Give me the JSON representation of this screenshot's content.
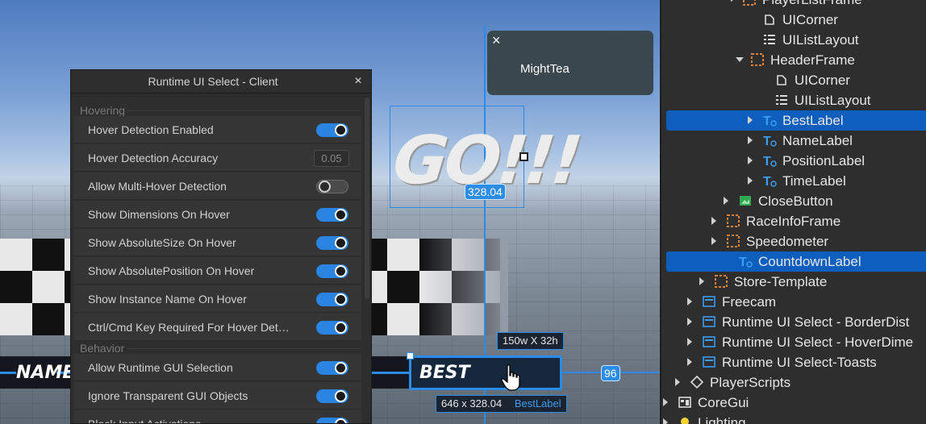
{
  "viewport": {
    "go_text": "GO!!!",
    "go_width_pill": "328.04",
    "name_label": "NAME",
    "best_label": "BEST",
    "size_tag": "150w X 32h",
    "right_gap_pill": "96",
    "position_tag": "646 x 328.04",
    "position_tag_name": "BestLabel",
    "colors": {
      "accent": "#2a8be8",
      "selection": "#0e5fbd"
    }
  },
  "player_popup": {
    "close_icon": "×",
    "player_name": "MightTea"
  },
  "runtime_select": {
    "title": "Runtime UI Select - Client",
    "close_icon": "×",
    "sections": [
      {
        "label": "Hovering"
      },
      {
        "label": "Behavior"
      }
    ],
    "rows": [
      {
        "label": "Hover Detection Enabled",
        "kind": "toggle",
        "on": true
      },
      {
        "label": "Hover Detection Accuracy",
        "kind": "number",
        "value": "0.05"
      },
      {
        "label": "Allow Multi-Hover Detection",
        "kind": "toggle",
        "on": false
      },
      {
        "label": "Show Dimensions On Hover",
        "kind": "toggle",
        "on": true
      },
      {
        "label": "Show AbsoluteSize On Hover",
        "kind": "toggle",
        "on": true
      },
      {
        "label": "Show AbsolutePosition On Hover",
        "kind": "toggle",
        "on": true
      },
      {
        "label": "Show Instance Name On Hover",
        "kind": "toggle",
        "on": true
      },
      {
        "label": "Ctrl/Cmd Key Required For Hover Det…",
        "kind": "toggle",
        "on": true
      },
      {
        "label": "Allow Runtime GUI Selection",
        "kind": "toggle",
        "on": true
      },
      {
        "label": "Ignore Transparent GUI Objects",
        "kind": "toggle",
        "on": true
      },
      {
        "label": "Block Input Activations",
        "kind": "toggle",
        "on": true
      }
    ]
  },
  "explorer": {
    "items": [
      {
        "label": "PlayerListFrame",
        "icon": "frame-icon",
        "expand": "down"
      },
      {
        "label": "UICorner",
        "icon": "uicorner-icon",
        "expand": "none"
      },
      {
        "label": "UIListLayout",
        "icon": "uilistlayout-icon",
        "expand": "none"
      },
      {
        "label": "HeaderFrame",
        "icon": "frame-icon",
        "expand": "down"
      },
      {
        "label": "UICorner",
        "icon": "uicorner-icon",
        "expand": "none"
      },
      {
        "label": "UIListLayout",
        "icon": "uilistlayout-icon",
        "expand": "none"
      },
      {
        "label": "BestLabel",
        "icon": "textlabel-icon",
        "expand": "right",
        "selected": true
      },
      {
        "label": "NameLabel",
        "icon": "textlabel-icon",
        "expand": "right"
      },
      {
        "label": "PositionLabel",
        "icon": "textlabel-icon",
        "expand": "right"
      },
      {
        "label": "TimeLabel",
        "icon": "textlabel-icon",
        "expand": "right"
      },
      {
        "label": "CloseButton",
        "icon": "imagebutton-icon",
        "expand": "right"
      },
      {
        "label": "RaceInfoFrame",
        "icon": "frame-icon",
        "expand": "right"
      },
      {
        "label": "Speedometer",
        "icon": "frame-icon",
        "expand": "right"
      },
      {
        "label": "CountdownLabel",
        "icon": "textlabel-icon",
        "expand": "none",
        "selected": true
      },
      {
        "label": "Store-Template",
        "icon": "frame-icon",
        "expand": "right"
      },
      {
        "label": "Freecam",
        "icon": "screengui-icon",
        "expand": "right"
      },
      {
        "label": "Runtime UI Select - BorderDist",
        "icon": "screengui-icon",
        "expand": "right"
      },
      {
        "label": "Runtime UI Select - HoverDime",
        "icon": "screengui-icon",
        "expand": "right"
      },
      {
        "label": "Runtime UI Select-Toasts",
        "icon": "screengui-icon",
        "expand": "right"
      },
      {
        "label": "PlayerScripts",
        "icon": "playerscripts-icon",
        "expand": "right"
      },
      {
        "label": "CoreGui",
        "icon": "coregui-icon",
        "expand": "right"
      },
      {
        "label": "Lighting",
        "icon": "lighting-icon",
        "expand": "right"
      }
    ]
  }
}
